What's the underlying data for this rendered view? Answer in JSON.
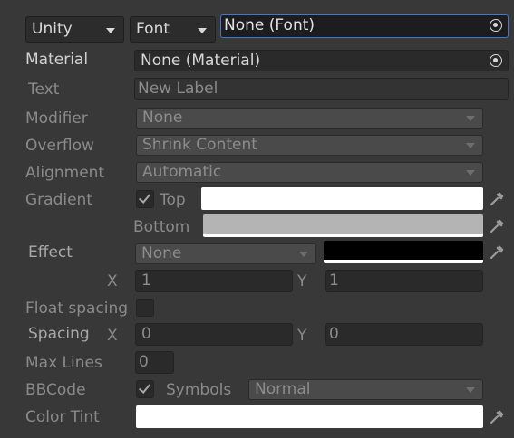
{
  "top_row": {
    "unity_dropdown": "Unity",
    "font_dropdown": "Font",
    "font_object_field": "None (Font)"
  },
  "material": {
    "label": "Material",
    "value": "None (Material)"
  },
  "text": {
    "label": "Text",
    "placeholder": "New Label"
  },
  "modifier": {
    "label": "Modifier",
    "value": "None"
  },
  "overflow": {
    "label": "Overflow",
    "value": "Shrink Content"
  },
  "alignment": {
    "label": "Alignment",
    "value": "Automatic"
  },
  "gradient": {
    "label": "Gradient",
    "checked": true,
    "top_label": "Top",
    "top_color": "#ffffff",
    "bottom_label": "Bottom",
    "bottom_color": "#b4b4b4"
  },
  "effect": {
    "label": "Effect",
    "value": "None",
    "color": "#000000",
    "x_label": "X",
    "x_value": "1",
    "y_label": "Y",
    "y_value": "1"
  },
  "float_spacing": {
    "label": "Float spacing",
    "checked": false
  },
  "spacing": {
    "label": "Spacing",
    "x_label": "X",
    "x_value": "0",
    "y_label": "Y",
    "y_value": "0"
  },
  "max_lines": {
    "label": "Max Lines",
    "value": "0"
  },
  "bbcode": {
    "label": "BBCode",
    "checked": true,
    "symbols_label": "Symbols",
    "symbols_value": "Normal"
  },
  "color_tint": {
    "label": "Color Tint",
    "color": "#ffffff"
  },
  "icons": [
    "object-picker-target-icon",
    "eyedropper-icon",
    "dropdown-caret-icon",
    "checkmark-icon"
  ]
}
